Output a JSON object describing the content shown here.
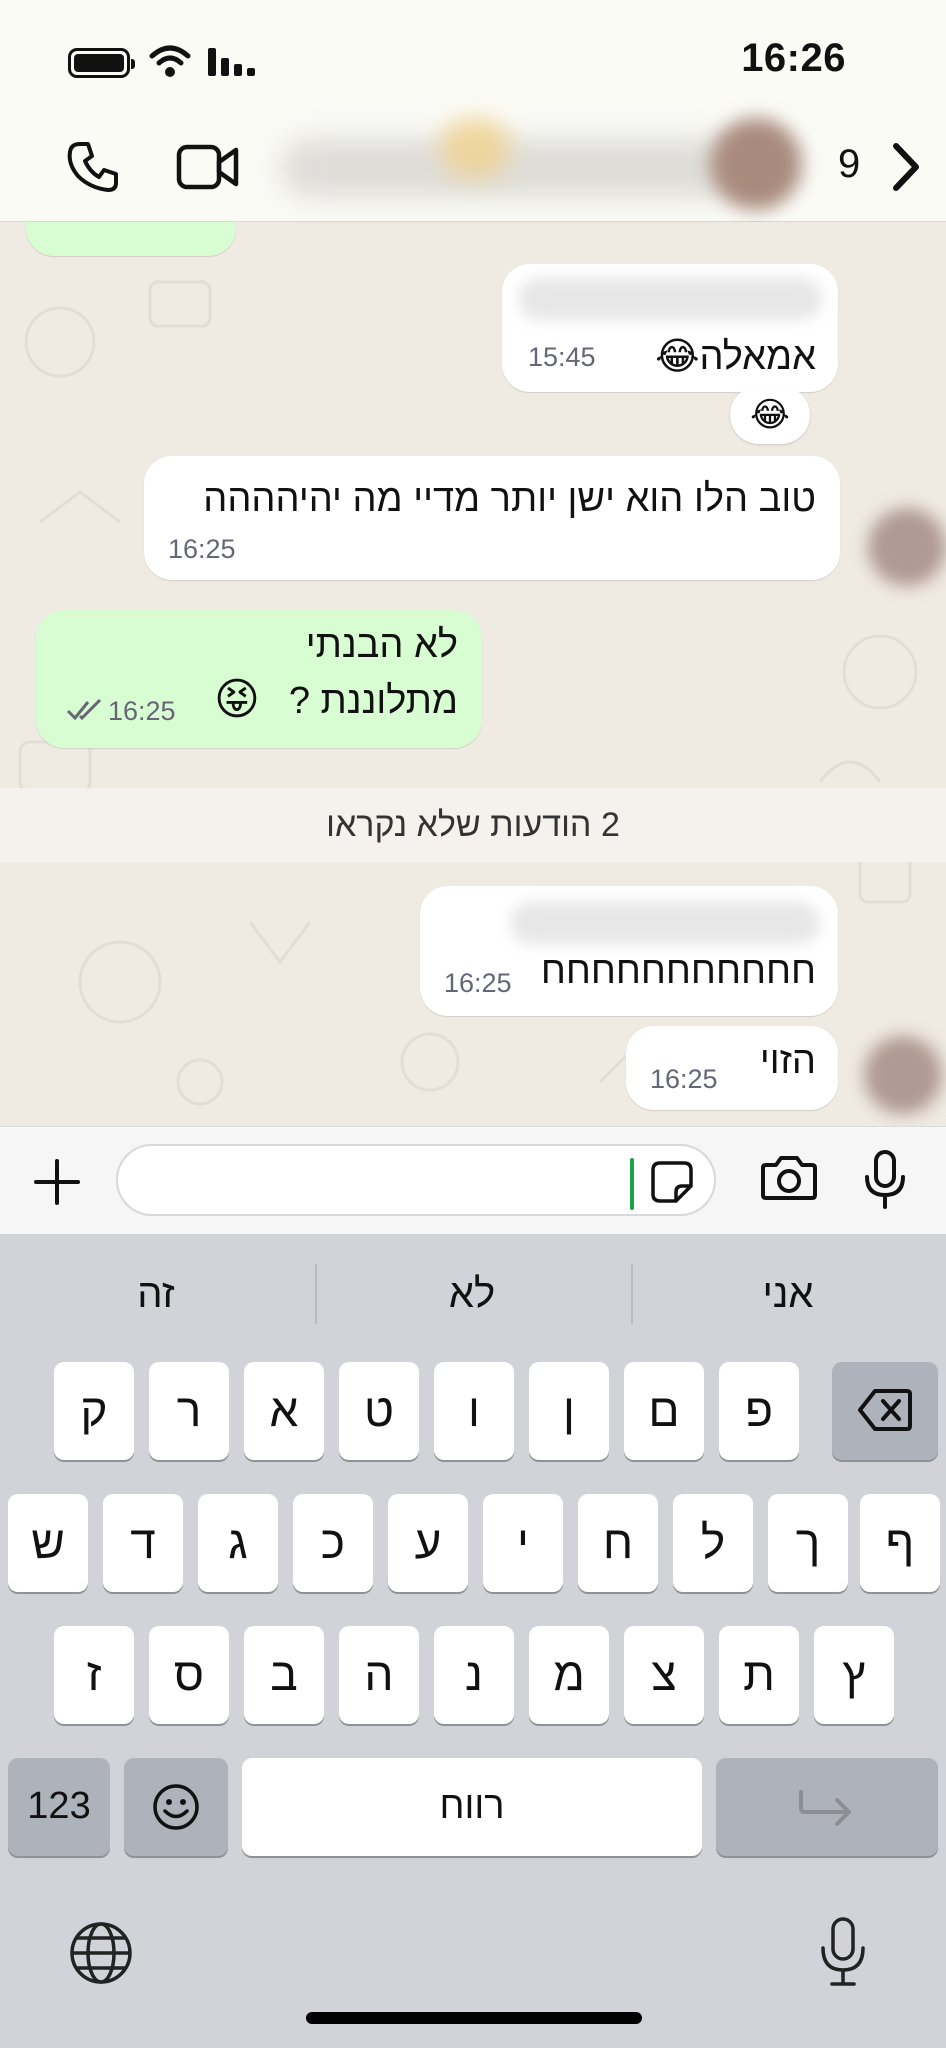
{
  "status_bar": {
    "time": "16:26"
  },
  "header": {
    "unread_count": "9"
  },
  "messages": [
    {
      "direction": "in",
      "text": "אמאלה😂",
      "time": "15:45",
      "reaction": "😂"
    },
    {
      "direction": "in",
      "text": "טוב הלו הוא ישן יותר מדיי מה יהיהההה",
      "time": "16:25"
    },
    {
      "direction": "out",
      "text_line1": "לא הבנתי",
      "text_line2": "מתלוננת ?",
      "emoji": "😝",
      "time": "16:25"
    },
    {
      "direction": "in",
      "text": "חחחחחחחחחחח",
      "time": "16:25"
    },
    {
      "direction": "in",
      "text": "הזוי",
      "time": "16:25"
    }
  ],
  "unread_banner": "2 הודעות שלא נקראו",
  "keyboard": {
    "suggestions": [
      "זה",
      "לא",
      "אני"
    ],
    "row1": [
      "ק",
      "ר",
      "א",
      "ט",
      "ו",
      "ן",
      "ם",
      "פ"
    ],
    "row2": [
      "ש",
      "ד",
      "ג",
      "כ",
      "ע",
      "י",
      "ח",
      "ל",
      "ך",
      "ף"
    ],
    "row3": [
      "ז",
      "ס",
      "ב",
      "ה",
      "נ",
      "מ",
      "צ",
      "ת",
      "ץ"
    ],
    "numbers_key": "123",
    "space_key": "רווח"
  },
  "colors": {
    "outgoing_bubble": "#d9fdd3",
    "incoming_bubble": "#ffffff",
    "chat_bg": "#efeae2",
    "cursor": "#1aa34a"
  }
}
